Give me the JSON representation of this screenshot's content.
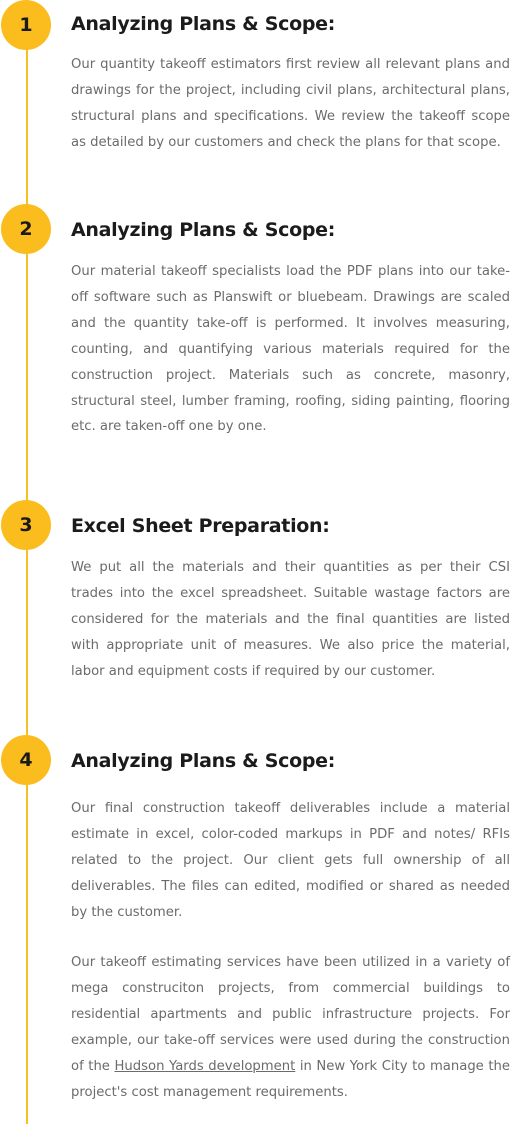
{
  "steps": [
    {
      "number": "1",
      "title": "Analyzing Plans & Scope:",
      "body": "Our quantity takeoff estimators first review all relevant plans and drawings for the project, including civil plans, architectural plans, structural plans and specifications. We review the takeoff scope as detailed by our customers and check the plans for that scope."
    },
    {
      "number": "2",
      "title": "Analyzing Plans & Scope:",
      "body": "Our material takeoff specialists load the PDF plans into our take-off software such as Planswift or bluebeam. Drawings are scaled and the quantity take-off is performed. It involves measuring, counting, and quantifying various materials required for the construction project. Materials such as concrete, masonry, structural steel, lumber framing, roofing, siding painting, flooring etc. are taken-off one by one."
    },
    {
      "number": "3",
      "title": "Excel Sheet Preparation:",
      "body": "We put all the materials and their quantities as per their CSI trades into the excel spreadsheet. Suitable wastage factors are considered for the materials and the final quantities are listed with appropriate unit of measures. We also price the material, labor and equipment costs if required by our customer."
    },
    {
      "number": "4",
      "title": "Analyzing Plans & Scope:",
      "body": "Our final construction takeoff deliverables include a material estimate in excel, color-coded markups in PDF and notes/ RFIs related to the project. Our client gets full ownership of all deliverables. The files can edited, modified or shared as needed by the customer.",
      "extra_before_link": "Our takeoff estimating services have been utilized in a variety of mega construciton projects, from commercial buildings to residential apartments and public infrastructure projects. For example, our take-off services were used during the construction of the ",
      "link_text": "Hudson Yards development",
      "extra_after_link": " in New York City to manage the project's cost management requirements."
    }
  ],
  "colors": {
    "accent": "#fbbd1e",
    "title": "#1b1b1b",
    "body": "#6b6b6b"
  }
}
